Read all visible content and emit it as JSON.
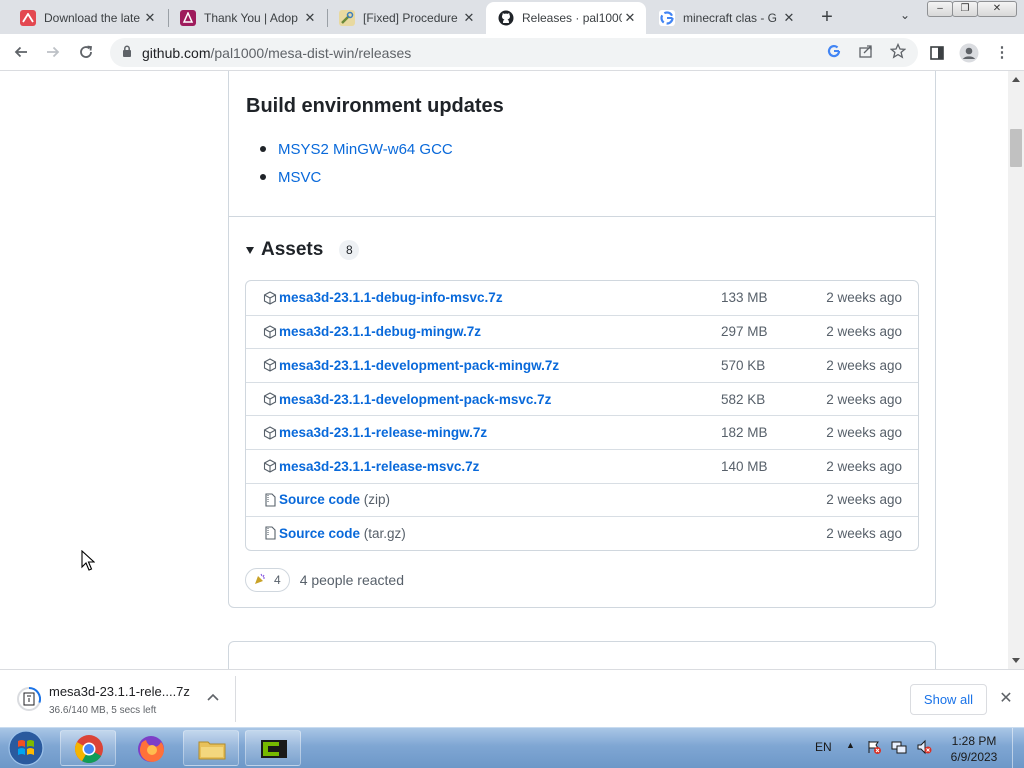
{
  "browser": {
    "tabs": [
      {
        "title": "Download the late",
        "favicon": "adobe-pdf-icon",
        "color": "#e34850"
      },
      {
        "title": "Thank You | Adop",
        "favicon": "adobe-acrobat-icon",
        "color": "#9e1b5c"
      },
      {
        "title": "[Fixed] Procedure",
        "favicon": "tools-icon",
        "color": "#c4a43a"
      },
      {
        "title": "Releases · pal1000",
        "favicon": "github-icon",
        "color": "#1f2328"
      },
      {
        "title": "minecraft clas - G",
        "favicon": "google-icon",
        "color": "#4285f4"
      }
    ],
    "address": {
      "domain": "github.com",
      "path": "/pal1000/mesa-dist-win/releases"
    }
  },
  "release": {
    "build_heading": "Build environment updates",
    "build_items": [
      "MSYS2 MinGW-w64 GCC",
      "MSVC"
    ],
    "assets_title": "Assets",
    "assets_count": "8",
    "assets": [
      {
        "name": "mesa3d-23.1.1-debug-info-msvc.7z",
        "suffix": "",
        "size": "133 MB",
        "date": "2 weeks ago",
        "kind": "package-icon"
      },
      {
        "name": "mesa3d-23.1.1-debug-mingw.7z",
        "suffix": "",
        "size": "297 MB",
        "date": "2 weeks ago",
        "kind": "package-icon"
      },
      {
        "name": "mesa3d-23.1.1-development-pack-mingw.7z",
        "suffix": "",
        "size": "570 KB",
        "date": "2 weeks ago",
        "kind": "package-icon"
      },
      {
        "name": "mesa3d-23.1.1-development-pack-msvc.7z",
        "suffix": "",
        "size": "582 KB",
        "date": "2 weeks ago",
        "kind": "package-icon"
      },
      {
        "name": "mesa3d-23.1.1-release-mingw.7z",
        "suffix": "",
        "size": "182 MB",
        "date": "2 weeks ago",
        "kind": "package-icon"
      },
      {
        "name": "mesa3d-23.1.1-release-msvc.7z",
        "suffix": "",
        "size": "140 MB",
        "date": "2 weeks ago",
        "kind": "package-icon"
      },
      {
        "name": "Source code",
        "suffix": " (zip)",
        "size": "",
        "date": "2 weeks ago",
        "kind": "file-zip-icon"
      },
      {
        "name": "Source code",
        "suffix": " (tar.gz)",
        "size": "",
        "date": "2 weeks ago",
        "kind": "file-zip-icon"
      }
    ],
    "reaction_count": "4",
    "reaction_text": "4 people reacted"
  },
  "download": {
    "filename": "mesa3d-23.1.1-rele....7z",
    "status": "36.6/140 MB, 5 secs left",
    "show_all": "Show all"
  },
  "taskbar": {
    "language": "EN",
    "time": "1:28 PM",
    "date": "6/9/2023"
  },
  "colors": {
    "link": "#0969da",
    "chrome_blue": "#1a73e8",
    "border": "#d0d7de"
  }
}
